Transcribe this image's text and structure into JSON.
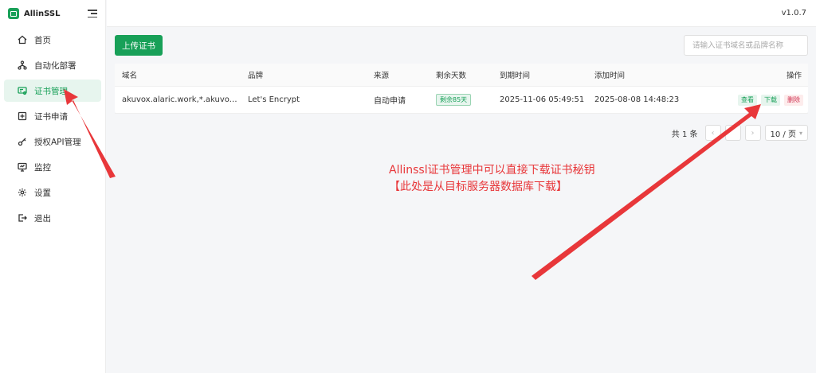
{
  "app": {
    "name": "AllinSSL",
    "version": "v1.0.7"
  },
  "sidebar": {
    "items": [
      {
        "label": "首页",
        "icon": "home-icon"
      },
      {
        "label": "自动化部署",
        "icon": "workflow-icon"
      },
      {
        "label": "证书管理",
        "icon": "certificate-icon",
        "active": true
      },
      {
        "label": "证书申请",
        "icon": "plus-square-icon"
      },
      {
        "label": "授权API管理",
        "icon": "key-icon"
      },
      {
        "label": "监控",
        "icon": "monitor-icon"
      },
      {
        "label": "设置",
        "icon": "gear-icon"
      },
      {
        "label": "退出",
        "icon": "logout-icon"
      }
    ]
  },
  "toolbar": {
    "upload_label": "上传证书",
    "search_placeholder": "请输入证书域名或品牌名称"
  },
  "table": {
    "headers": {
      "domain": "域名",
      "brand": "品牌",
      "source": "来源",
      "days": "剩余天数",
      "expire": "到期时间",
      "added": "添加时间",
      "ops": "操作"
    },
    "rows": [
      {
        "domain": "akuvox.alaric.work,*.akuvox.al...",
        "brand": "Let's Encrypt",
        "source": "自动申请",
        "days": "剩余85天",
        "expire": "2025-11-06 05:49:51",
        "added": "2025-08-08 14:48:23"
      }
    ],
    "ops": {
      "view": "查看",
      "download": "下载",
      "delete": "删除"
    }
  },
  "pagination": {
    "total": "共 1 条",
    "page_size": "10 / 页"
  },
  "annotation": {
    "line1": "Allinssl证书管理中可以直接下载证书秘钥",
    "line2": "【此处是从目标服务器数据库下载】",
    "color": "#e8373a"
  },
  "colors": {
    "accent": "#18a058",
    "danger": "#d03050"
  }
}
